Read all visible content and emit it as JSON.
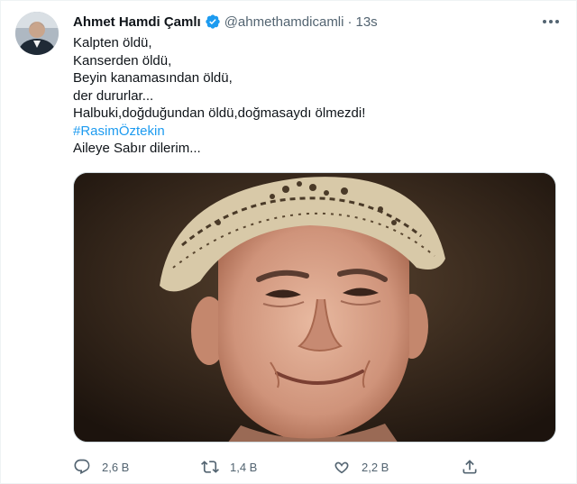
{
  "tweet": {
    "author_name": "Ahmet Hamdi Çamlı",
    "author_handle": "@ahmethamdicamli",
    "separator": "·",
    "time": "13s",
    "lines": [
      "Kalpten öldü,",
      "Kanserden öldü,",
      "Beyin kanamasından öldü,",
      "der dururlar...",
      "Halbuki,doğduğundan öldü,doğmasaydı ölmezdi!"
    ],
    "hashtag": "#RasimÖztekin",
    "closing": "Aileye Sabır dilerim...",
    "media_alt": "Rasim Öztekin fotoğrafı"
  },
  "actions": {
    "reply_count": "2,6 B",
    "retweet_count": "1,4 B",
    "like_count": "2,2 B"
  },
  "colors": {
    "link": "#1d9bf0",
    "secondary_text": "#536471",
    "verified_badge": "#1d9bf0"
  },
  "icons": [
    "more-icon",
    "verified-icon",
    "reply-icon",
    "retweet-icon",
    "like-icon",
    "share-icon"
  ]
}
